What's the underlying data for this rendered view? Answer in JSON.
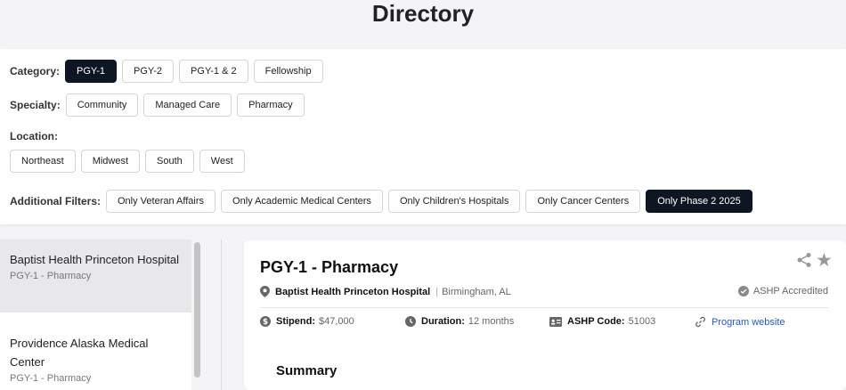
{
  "header": {
    "title": "Directory"
  },
  "filters": {
    "category": {
      "label": "Category:",
      "options": [
        "PGY-1",
        "PGY-2",
        "PGY-1 & 2",
        "Fellowship"
      ]
    },
    "specialty": {
      "label": "Specialty:",
      "options": [
        "Community",
        "Managed Care",
        "Pharmacy"
      ]
    },
    "location": {
      "label": "Location:",
      "options": [
        "Northeast",
        "Midwest",
        "South",
        "West"
      ]
    },
    "additional": {
      "label": "Additional Filters:",
      "options": [
        "Only Veteran Affairs",
        "Only Academic Medical Centers",
        "Only Children's Hospitals",
        "Only Cancer Centers",
        "Only Phase 2 2025"
      ]
    }
  },
  "list": {
    "items": [
      {
        "name": "Baptist Health Princeton Hospital",
        "sub": "PGY-1 - Pharmacy"
      },
      {
        "name": "Providence Alaska Medical Center",
        "sub": "PGY-1 - Pharmacy"
      }
    ]
  },
  "detail": {
    "title": "PGY-1 - Pharmacy",
    "hospital": "Baptist Health Princeton Hospital",
    "separator": "|",
    "city": "Birmingham, AL",
    "accreditation": "ASHP Accredited",
    "stipend_label": "Stipend:",
    "stipend_value": "$47,000",
    "duration_label": "Duration:",
    "duration_value": "12 months",
    "code_label": "ASHP Code:",
    "code_value": "51003",
    "website_label": "Program website",
    "summary_heading": "Summary"
  },
  "colors": {
    "active_chip": "#0f1623",
    "link": "#2456c9",
    "selected_item": "#e8e8ea"
  }
}
